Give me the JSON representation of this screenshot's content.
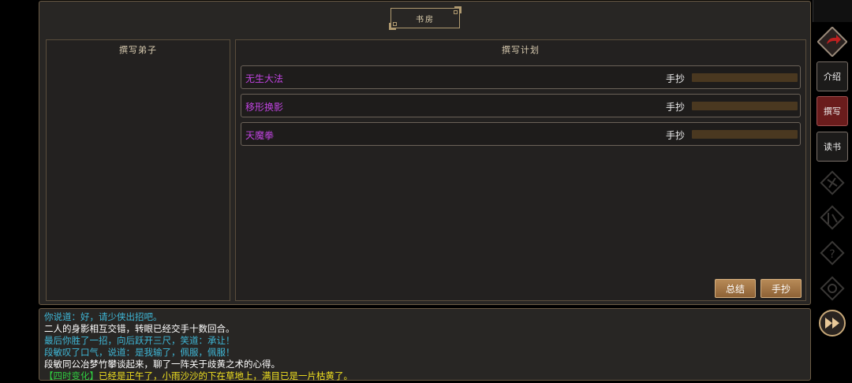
{
  "window": {
    "title": "书房"
  },
  "left_panel": {
    "title": "撰写弟子"
  },
  "right_panel": {
    "title": "撰写计划",
    "plans": [
      {
        "name": "无生大法",
        "method": "手抄",
        "progress": 0
      },
      {
        "name": "移形换影",
        "method": "手抄",
        "progress": 0
      },
      {
        "name": "天魔拳",
        "method": "手抄",
        "progress": 0
      }
    ]
  },
  "buttons": {
    "summary": "总结",
    "copy": "手抄"
  },
  "sidebar": {
    "tabs": [
      {
        "label": "介绍",
        "active": false
      },
      {
        "label": "撰写",
        "active": true
      },
      {
        "label": "读书",
        "active": false
      }
    ]
  },
  "log": {
    "lines": [
      {
        "text": "你说道：好，请少侠出招吧。",
        "color": "#3fb8d8"
      },
      {
        "text": "二人的身影相互交错，转眼已经交手十数回合。",
        "color": "#ffffff"
      },
      {
        "text": "最后你胜了一招，向后跃开三尺，笑道：承让！",
        "color": "#3fb8d8"
      },
      {
        "text": "段敏叹了口气，说道：是我输了，佩服，佩服！",
        "color": "#3fb8d8"
      },
      {
        "text": "段敏同公冶梦竹攀谈起来，聊了一阵关于歧黄之术的心得。",
        "color": "#ffffff"
      },
      {
        "text": "【四时变化】已经是正午了，小雨沙沙的下在草地上，满目已是一片枯黄了。",
        "color": "#f0e020",
        "prefix_color": "#30d040"
      }
    ]
  },
  "colors": {
    "accent": "#c044e0",
    "frame": "#6b5b45"
  }
}
